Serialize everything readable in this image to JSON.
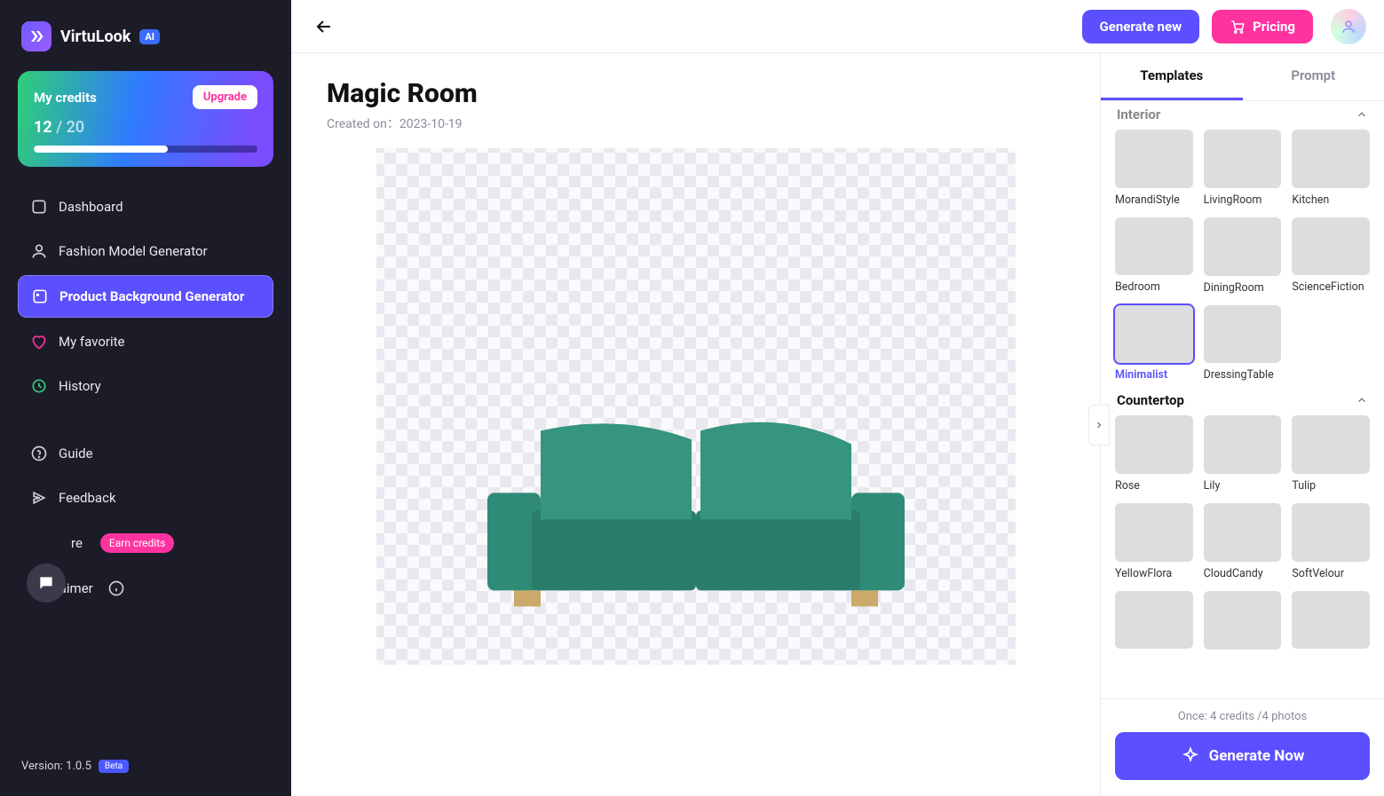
{
  "brand": {
    "name": "VirtuLook",
    "ai_badge": "AI"
  },
  "credits": {
    "title": "My credits",
    "upgrade": "Upgrade",
    "used": "12",
    "total": "20",
    "percent": 60
  },
  "sidebar": {
    "items": [
      {
        "label": "Dashboard"
      },
      {
        "label": "Fashion Model Generator"
      },
      {
        "label": "Product Background Generator"
      },
      {
        "label": "My favorite"
      },
      {
        "label": "History"
      }
    ],
    "secondary": [
      {
        "label": "Guide"
      },
      {
        "label": "Feedback"
      },
      {
        "label": "re",
        "pill": "Earn credits"
      },
      {
        "label": "Disclaimer"
      }
    ]
  },
  "version": {
    "label": "Version: 1.0.5",
    "badge": "Beta"
  },
  "header": {
    "generate_new": "Generate new",
    "pricing": "Pricing"
  },
  "page": {
    "title": "Magic Room",
    "created_label": "Created on：",
    "created_date": "2023-10-19"
  },
  "panel": {
    "tabs": {
      "templates": "Templates",
      "prompt": "Prompt"
    },
    "sections": {
      "interior": {
        "title": "Interior",
        "items": [
          {
            "label": "MorandiStyle",
            "cls": "th-morandi"
          },
          {
            "label": "LivingRoom",
            "cls": "th-living"
          },
          {
            "label": "Kitchen",
            "cls": "th-kitchen"
          },
          {
            "label": "Bedroom",
            "cls": "th-bedroom"
          },
          {
            "label": "DiningRoom",
            "cls": "th-dining"
          },
          {
            "label": "ScienceFiction",
            "cls": "th-scifi"
          },
          {
            "label": "Minimalist",
            "cls": "th-min",
            "selected": true
          },
          {
            "label": "DressingTable",
            "cls": "th-dress"
          }
        ]
      },
      "countertop": {
        "title": "Countertop",
        "items": [
          {
            "label": "Rose",
            "cls": "th-rose"
          },
          {
            "label": "Lily",
            "cls": "th-lily"
          },
          {
            "label": "Tulip",
            "cls": "th-tulip"
          },
          {
            "label": "YellowFlora",
            "cls": "th-yflora"
          },
          {
            "label": "CloudCandy",
            "cls": "th-cloud"
          },
          {
            "label": "SoftVelour",
            "cls": "th-velour"
          }
        ]
      }
    },
    "footer": {
      "cost": "Once: 4 credits /4 photos",
      "generate": "Generate Now"
    }
  }
}
